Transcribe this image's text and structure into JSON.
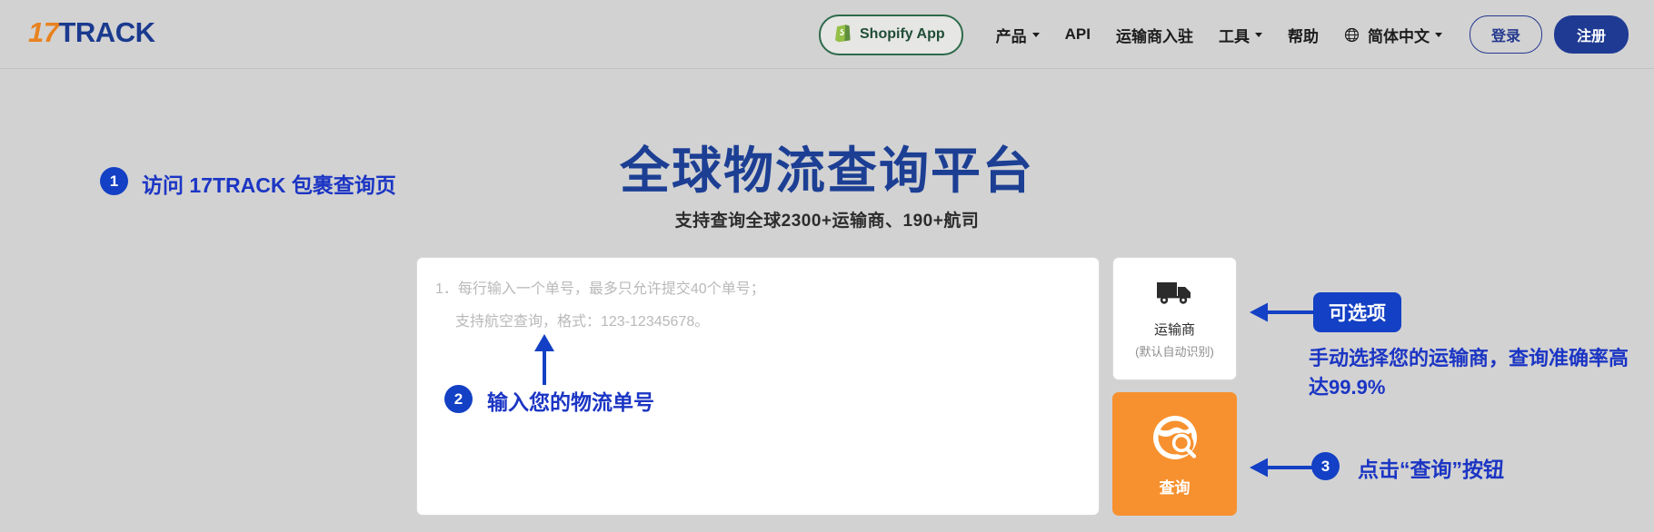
{
  "header": {
    "logo": {
      "number": "17",
      "word": "TRACK"
    },
    "shopify_button": {
      "label": "Shopify App",
      "icon": "shopify-bag-icon",
      "border_color": "#2d6a4a"
    },
    "nav_items": [
      {
        "label": "产品",
        "has_caret": true
      },
      {
        "label": "API",
        "has_caret": false
      },
      {
        "label": "运输商入驻",
        "has_caret": false
      },
      {
        "label": "工具",
        "has_caret": true
      },
      {
        "label": "帮助",
        "has_caret": false
      }
    ],
    "language": {
      "label": "简体中文",
      "icon": "globe-icon",
      "has_caret": true
    },
    "login_label": "登录",
    "register_label": "注册",
    "accent_blue": "#1f3a93"
  },
  "hero": {
    "title": "全球物流查询平台",
    "subtitle": "支持查询全球2300+运输商、190+航司",
    "title_color": "#1c3f94"
  },
  "form": {
    "textarea": {
      "placeholder_line1": "1．每行输入一个单号，最多只允许提交40个单号；",
      "placeholder_line2": "支持航空查询，格式：123-12345678。",
      "value": ""
    },
    "carrier": {
      "icon": "truck-icon",
      "label": "运输商",
      "sublabel": "(默认自动识别)"
    },
    "search": {
      "icon": "globe-search-icon",
      "label": "查询",
      "color": "#f7912f"
    }
  },
  "annotations": {
    "step1": {
      "number": "1",
      "text": "访问 17TRACK 包裹查询页"
    },
    "step2": {
      "number": "2",
      "text": "输入您的物流单号",
      "arrow": "arrow-up-icon"
    },
    "optional": {
      "badge": "可选项",
      "description": "手动选择您的运输商，查询准确率高达99.9%",
      "arrow": "arrow-left-icon"
    },
    "step3": {
      "number": "3",
      "text": "点击“查询”按钮",
      "arrow": "arrow-left-icon"
    },
    "color": "#1b35c4"
  }
}
